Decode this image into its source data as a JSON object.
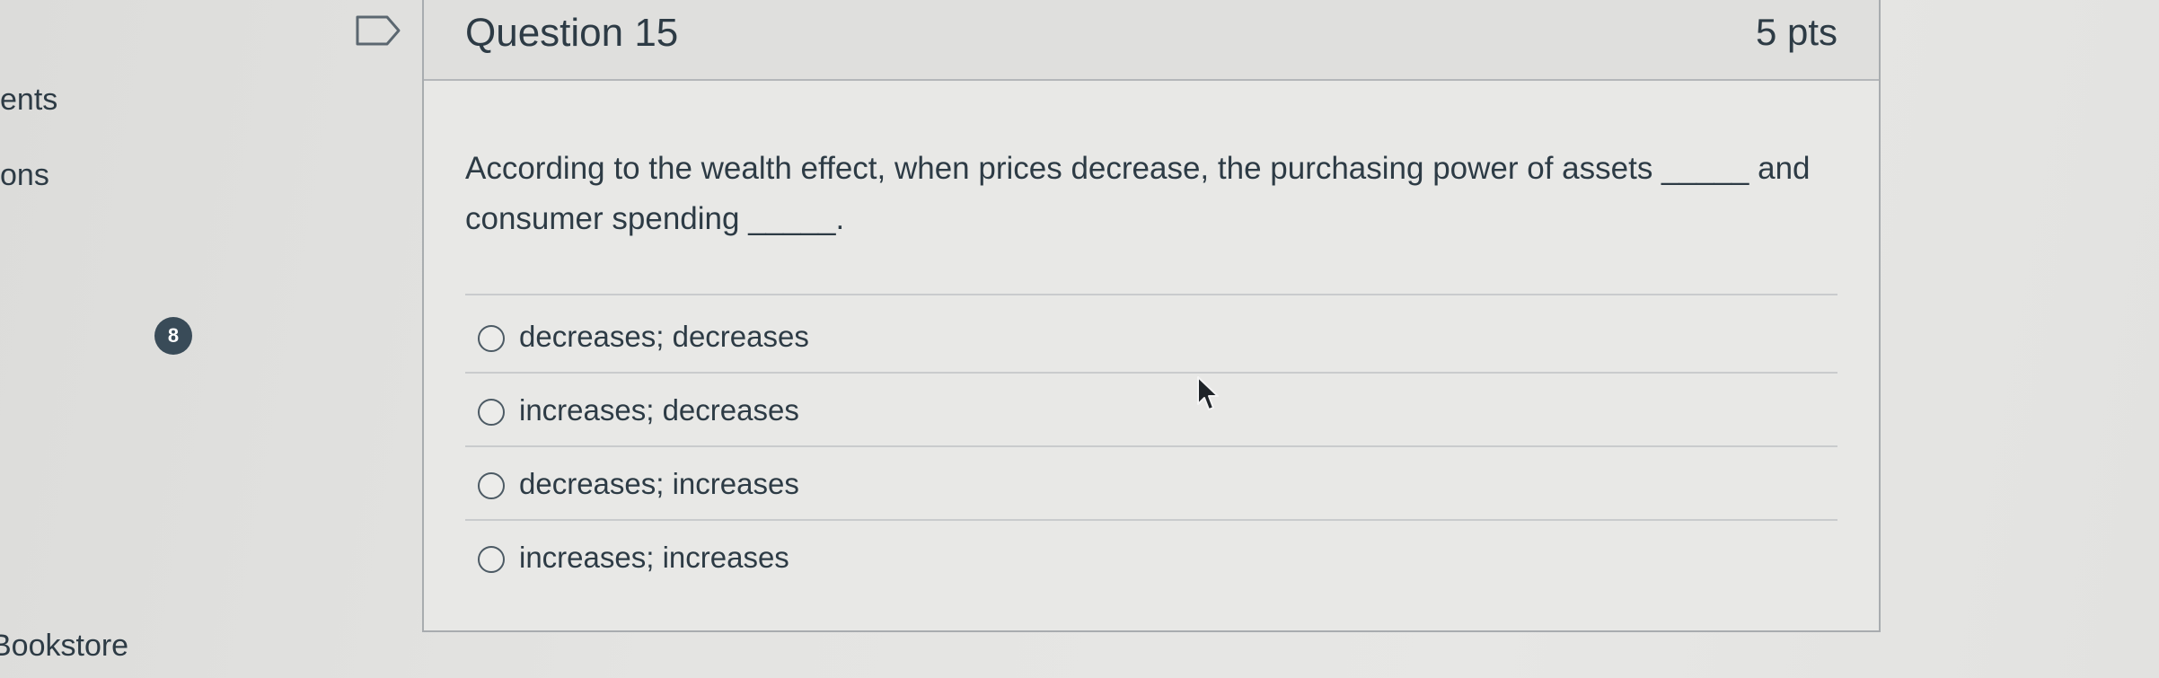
{
  "sidebar": {
    "items": [
      {
        "label": "ents"
      },
      {
        "label": "ons"
      },
      {
        "label": "Bookstore"
      }
    ],
    "badge_count": "8"
  },
  "question": {
    "title": "Question 15",
    "points": "5 pts",
    "text": "According to the wealth effect, when prices decrease, the purchasing power of assets _____ and consumer spending _____.",
    "answers": [
      {
        "label": "decreases; decreases"
      },
      {
        "label": "increases; decreases"
      },
      {
        "label": "decreases; increases"
      },
      {
        "label": "increases; increases"
      }
    ]
  },
  "icons": {
    "flag": "flag-outline-icon",
    "cursor": "mouse-pointer-icon"
  },
  "colors": {
    "text": "#2d3b45",
    "badge": "#394b58",
    "border": "#a8acaf"
  }
}
